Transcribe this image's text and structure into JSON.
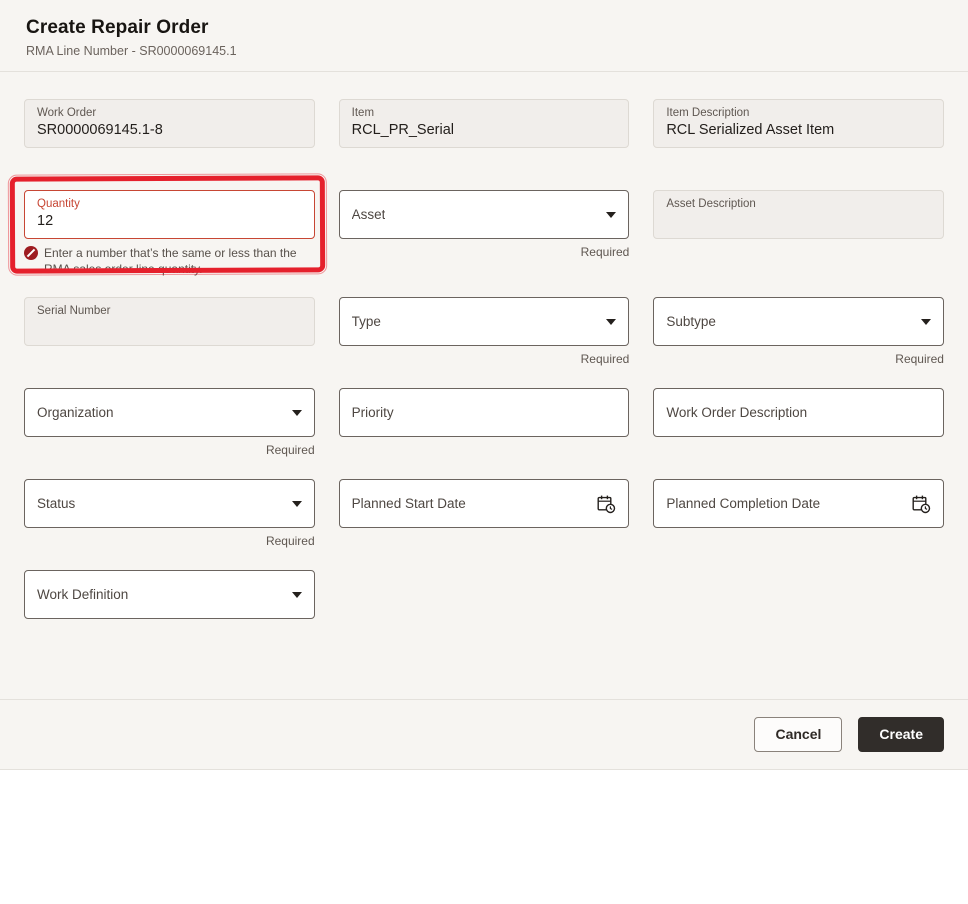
{
  "header": {
    "title": "Create Repair Order",
    "subtitle": "RMA Line Number - SR0000069145.1"
  },
  "fields": {
    "work_order": {
      "label": "Work Order",
      "value": "SR0000069145.1-8"
    },
    "item": {
      "label": "Item",
      "value": "RCL_PR_Serial"
    },
    "item_description": {
      "label": "Item Description",
      "value": "RCL Serialized Asset Item"
    },
    "quantity": {
      "label": "Quantity",
      "value": "12",
      "error_message": "Enter a number that’s the same or less than the RMA sales order line quantity."
    },
    "asset": {
      "label": "Asset",
      "required_text": "Required"
    },
    "asset_description": {
      "label": "Asset Description",
      "value": ""
    },
    "serial_number": {
      "label": "Serial Number",
      "value": ""
    },
    "type": {
      "label": "Type",
      "required_text": "Required"
    },
    "subtype": {
      "label": "Subtype",
      "required_text": "Required"
    },
    "organization": {
      "label": "Organization",
      "required_text": "Required"
    },
    "priority": {
      "label": "Priority"
    },
    "work_order_description": {
      "label": "Work Order Description"
    },
    "status": {
      "label": "Status",
      "required_text": "Required"
    },
    "planned_start_date": {
      "label": "Planned Start Date"
    },
    "planned_completion_date": {
      "label": "Planned Completion Date"
    },
    "work_definition": {
      "label": "Work Definition"
    }
  },
  "footer": {
    "cancel_label": "Cancel",
    "create_label": "Create"
  },
  "colors": {
    "error_red": "#c74634",
    "annotation_red": "#e5202c",
    "create_button_bg": "#312d2a",
    "form_background": "#f7f5f2"
  }
}
